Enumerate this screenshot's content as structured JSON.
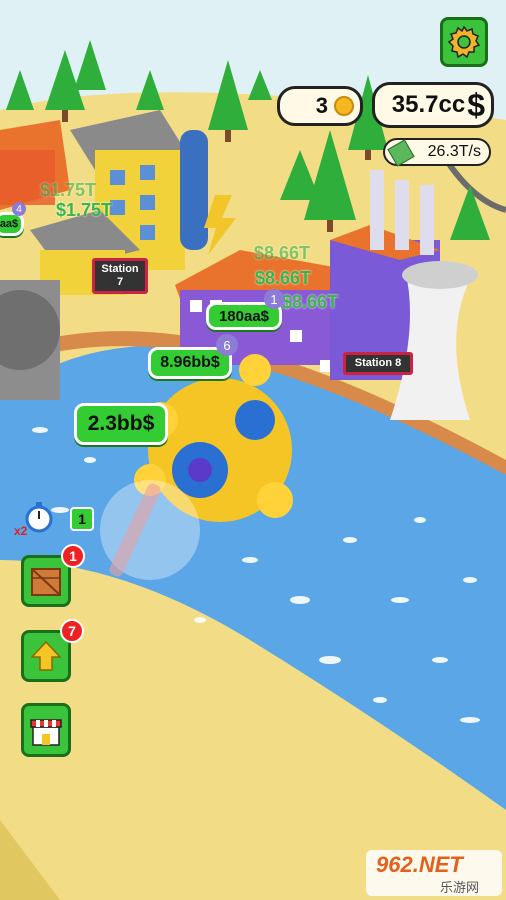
{
  "hud": {
    "coins": "3",
    "cash": "35.7cc",
    "cash_symbol": "$",
    "rate": "26.3T/s"
  },
  "stations": [
    {
      "label": "Station 7"
    },
    {
      "label": "Station 8"
    }
  ],
  "money_bubbles": {
    "b1": "180aa$",
    "b2": "8.96bb$",
    "b3": "2.3bb$",
    "b4": "aa$"
  },
  "floating_texts": [
    "$1.75T",
    "$1.75T",
    "$8.66T",
    "$8.66T",
    "$8.66T"
  ],
  "level_badges": [
    "4",
    "1",
    "6"
  ],
  "boost": {
    "multiplier": "x2",
    "count": "1"
  },
  "side_buttons": {
    "crate_badge": "1",
    "upgrade_badge": "7"
  },
  "watermark": {
    "text": "962.NET",
    "sub": "乐游网"
  }
}
